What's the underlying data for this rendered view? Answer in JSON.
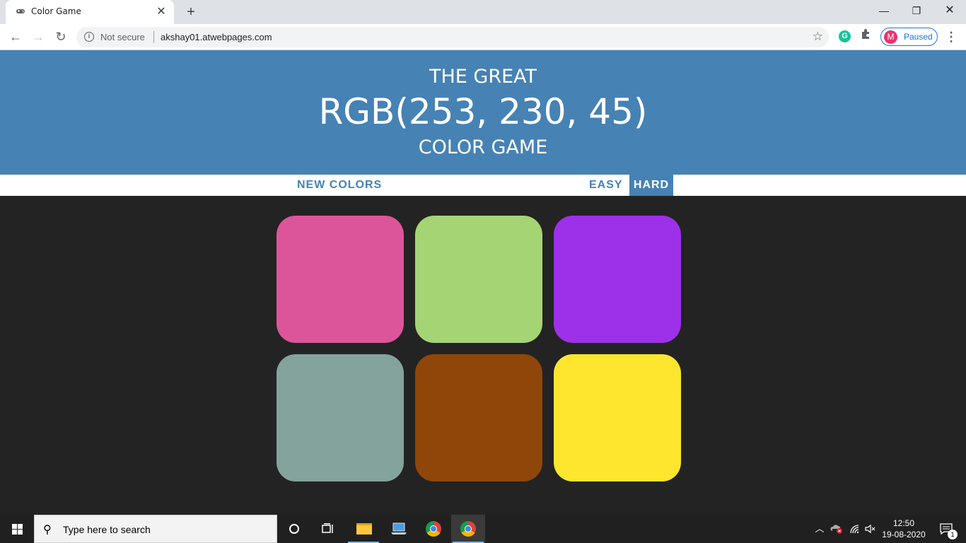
{
  "browser": {
    "tab_title": "Color Game",
    "tab_favicon": "gamepad-icon",
    "new_tab_label": "+",
    "security_label": "Not secure",
    "url": "akshay01.atwebpages.com",
    "profile_initial": "M",
    "profile_status": "Paused"
  },
  "game": {
    "title_top": "THE GREAT",
    "color_display": "RGB(253, 230, 45)",
    "title_bottom": "COLOR GAME",
    "new_colors_label": "NEW COLORS",
    "message": "",
    "easy_label": "EASY",
    "hard_label": "HARD",
    "selected_mode": "HARD",
    "header_color": "#4682b4",
    "background_color": "#232323",
    "squares": [
      {
        "color": "rgb(220, 85, 154)"
      },
      {
        "color": "rgb(165, 212, 117)"
      },
      {
        "color": "rgb(157, 49, 234)"
      },
      {
        "color": "rgb(133, 163, 157)"
      },
      {
        "color": "rgb(144, 70, 8)"
      },
      {
        "color": "rgb(253, 230, 45)"
      }
    ]
  },
  "taskbar": {
    "search_placeholder": "Type here to search",
    "time": "12:50",
    "date": "19-08-2020",
    "notification_count": "1"
  }
}
